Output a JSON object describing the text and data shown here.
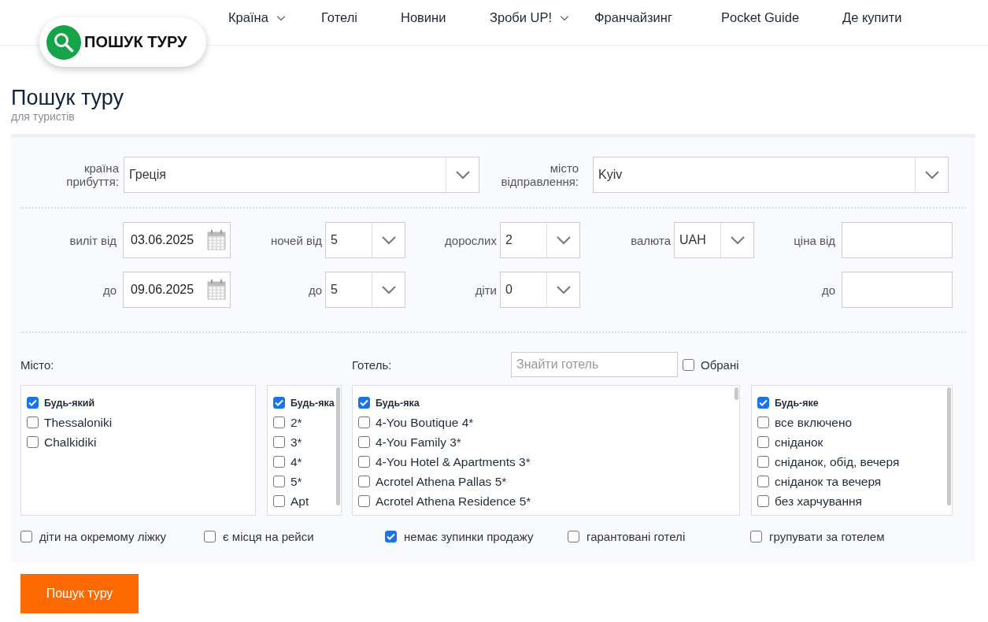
{
  "nav": {
    "items": [
      {
        "label": "Країна",
        "has_dropdown": true
      },
      {
        "label": "Готелі",
        "has_dropdown": false
      },
      {
        "label": "Новини",
        "has_dropdown": false
      },
      {
        "label": "Зроби UP!",
        "has_dropdown": true
      },
      {
        "label": "Франчайзинг",
        "has_dropdown": false
      },
      {
        "label": "Pocket Guide",
        "has_dropdown": false
      },
      {
        "label": "Де купити",
        "has_dropdown": false
      }
    ]
  },
  "logo": {
    "label": "ПОШУК ТУРУ"
  },
  "page": {
    "title": "Пошук туру",
    "subtitle": "для туристів"
  },
  "form": {
    "destination": [
      {
        "label": "країна прибуття:",
        "value": "Греція"
      },
      {
        "label": "місто відправлення:",
        "value": "Kyiv"
      }
    ],
    "rows": [
      [
        {
          "kind": "date",
          "label": "виліт від",
          "value": "03.06.2025"
        },
        {
          "kind": "select",
          "label": "ночей від",
          "value": "5"
        },
        {
          "kind": "select",
          "label": "дорослих",
          "value": "2"
        },
        {
          "kind": "select",
          "label": "валюта",
          "value": "UAH"
        },
        {
          "kind": "input",
          "label": "ціна від"
        }
      ],
      [
        {
          "kind": "date",
          "label": "до",
          "value": "09.06.2025"
        },
        {
          "kind": "select",
          "label": "до",
          "value": "5"
        },
        {
          "kind": "select",
          "label": "діти",
          "value": "0"
        },
        {
          "kind": "blank"
        },
        {
          "kind": "input",
          "label": "до"
        }
      ]
    ],
    "city_label": "Місто:",
    "hotel_label": "Готель:",
    "hotel_search": {
      "placeholder": "Знайти готель"
    },
    "favorites": {
      "label": "Обрані",
      "checked": false
    },
    "lists": [
      {
        "items": [
          {
            "kind": "all",
            "label": "Будь-який",
            "checked": true
          },
          {
            "kind": "option",
            "label": "Thessaloniki",
            "checked": false
          },
          {
            "kind": "option",
            "label": "Chalkidiki",
            "checked": false
          }
        ]
      },
      {
        "items": [
          {
            "kind": "all",
            "label": "Будь-яка",
            "checked": true
          },
          {
            "kind": "option",
            "label": "2*",
            "checked": false
          },
          {
            "kind": "option",
            "label": "3*",
            "checked": false
          },
          {
            "kind": "option",
            "label": "4*",
            "checked": false
          },
          {
            "kind": "option",
            "label": "5*",
            "checked": false
          },
          {
            "kind": "option",
            "label": "Apt",
            "checked": false
          }
        ]
      },
      {
        "items": [
          {
            "kind": "all",
            "label": "Будь-яка",
            "checked": true
          },
          {
            "kind": "option",
            "label": "4-You Boutique 4*",
            "checked": false
          },
          {
            "kind": "option",
            "label": "4-You Family 3*",
            "checked": false
          },
          {
            "kind": "option",
            "label": "4-You Hotel & Apartments 3*",
            "checked": false
          },
          {
            "kind": "option",
            "label": "Acrotel Athena Pallas 5*",
            "checked": false
          },
          {
            "kind": "option",
            "label": "Acrotel Athena Residence 5*",
            "checked": false
          }
        ]
      },
      {
        "items": [
          {
            "kind": "all",
            "label": "Будь-яке",
            "checked": true
          },
          {
            "kind": "option",
            "label": "все включено",
            "checked": false
          },
          {
            "kind": "option",
            "label": "сніданок",
            "checked": false
          },
          {
            "kind": "option",
            "label": "сніданок, обід, вечеря",
            "checked": false
          },
          {
            "kind": "option",
            "label": "сніданок та вечеря",
            "checked": false
          },
          {
            "kind": "option",
            "label": "без харчування",
            "checked": false
          }
        ]
      }
    ],
    "options": [
      {
        "label": "діти на окремому ліжку",
        "checked": false
      },
      {
        "label": "є місця на рейси",
        "checked": false
      },
      {
        "label": "немає зупинки продажу",
        "checked": true
      },
      {
        "label": "гарантовані готелі",
        "checked": false
      },
      {
        "label": "групувати за готелем",
        "checked": false
      }
    ]
  },
  "submit": {
    "label": "Пошук туру"
  }
}
